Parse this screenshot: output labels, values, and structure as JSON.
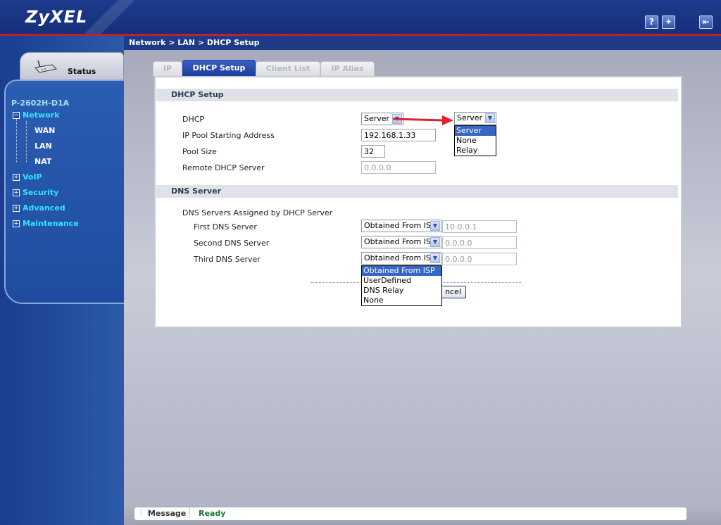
{
  "header": {
    "logo": "ZyXEL",
    "help_icon": "help-icon",
    "wizard_icon": "wizard-icon",
    "logout_icon": "logout-icon"
  },
  "sidebar": {
    "status_label": "Status",
    "device_name": "P-2602H-D1A",
    "menu": [
      {
        "label": "Network",
        "expander": "−",
        "children": [
          "WAN",
          "LAN",
          "NAT"
        ]
      },
      {
        "label": "VoIP",
        "expander": "+"
      },
      {
        "label": "Security",
        "expander": "+"
      },
      {
        "label": "Advanced",
        "expander": "+"
      },
      {
        "label": "Maintenance",
        "expander": "+"
      }
    ]
  },
  "breadcrumb": "Network > LAN > DHCP Setup",
  "tabs": [
    "IP",
    "DHCP Setup",
    "Client List",
    "IP Alias"
  ],
  "active_tab": "DHCP Setup",
  "dhcp": {
    "section_title": "DHCP Setup",
    "dhcp_label": "DHCP",
    "dhcp_value": "Server",
    "pool_start_label": "IP Pool Starting Address",
    "pool_start_value": "192.168.1.33",
    "pool_size_label": "Pool Size",
    "pool_size_value": "32",
    "remote_label": "Remote DHCP Server",
    "remote_value": "0.0.0.0",
    "dropdown_value": "Server",
    "dropdown_options": [
      "Server",
      "None",
      "Relay"
    ],
    "dropdown_selected": "Server"
  },
  "dns": {
    "section_title": "DNS Server",
    "assigned_label": "DNS Servers Assigned by DHCP Server",
    "first_label": "First DNS Server",
    "first_mode": "Obtained From ISP",
    "first_ip": "10.0.0.1",
    "second_label": "Second DNS Server",
    "second_mode": "Obtained From ISP",
    "second_ip": "0.0.0.0",
    "third_label": "Third DNS Server",
    "third_mode": "Obtained From ISP",
    "third_ip": "0.0.0.0",
    "dropdown_options": [
      "Obtained From ISP",
      "UserDefined",
      "DNS Relay",
      "None"
    ],
    "dropdown_selected": "Obtained From ISP"
  },
  "buttons": {
    "cancel_partial": "ncel"
  },
  "statusbar": {
    "label": "Message",
    "text": "Ready"
  },
  "colors": {
    "header_blue": "#1d3a8c",
    "accent_red": "#e0202a",
    "tab_active": "#1c3d9a",
    "selection": "#3667c6",
    "ready_green": "#107a3a"
  }
}
